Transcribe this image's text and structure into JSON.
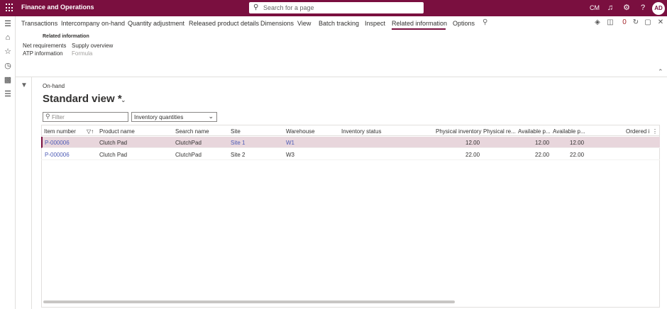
{
  "topbar": {
    "app_title": "Finance and Operations",
    "search_placeholder": "Search for a page",
    "company": "CM",
    "avatar_initials": "AD",
    "background": "#7a0f3f"
  },
  "action_pane": {
    "tabs": [
      {
        "label": "Transactions"
      },
      {
        "label": "Intercompany on-hand"
      },
      {
        "label": "Quantity adjustment"
      },
      {
        "label": "Released product details"
      },
      {
        "label": "Dimensions"
      },
      {
        "label": "View"
      },
      {
        "label": "Batch tracking"
      },
      {
        "label": "Inspect"
      },
      {
        "label": "Related information"
      },
      {
        "label": "Options"
      }
    ],
    "active_tab": "Related information",
    "group": {
      "title": "Related information",
      "links": [
        {
          "label": "Net requirements",
          "enabled": true
        },
        {
          "label": "Supply overview",
          "enabled": true
        },
        {
          "label": "ATP information",
          "enabled": true
        },
        {
          "label": "Formula",
          "enabled": false
        }
      ]
    },
    "notification_badge": "0"
  },
  "page": {
    "caption": "On-hand",
    "view_title": "Standard view *",
    "filter_placeholder": "Filter",
    "dropdown_value": "Inventory quantities"
  },
  "grid": {
    "columns": [
      {
        "label": "Item number"
      },
      {
        "label": "Product name"
      },
      {
        "label": "Search name"
      },
      {
        "label": "Site"
      },
      {
        "label": "Warehouse"
      },
      {
        "label": "Inventory status"
      },
      {
        "label": "Physical inventory"
      },
      {
        "label": "Physical re..."
      },
      {
        "label": "Available p..."
      },
      {
        "label": "Available p..."
      },
      {
        "label": "Ordered i"
      }
    ],
    "rows": [
      {
        "item_number": "P-000006",
        "product_name": "Clutch Pad",
        "search_name": "ClutchPad",
        "site": "Site 1",
        "warehouse": "W1",
        "inventory_status": "",
        "physical_inventory": "12.00",
        "available_1": "12.00",
        "available_2": "12.00",
        "selected": true
      },
      {
        "item_number": "P-000006",
        "product_name": "Clutch Pad",
        "search_name": "ClutchPad",
        "site": "Site 2",
        "warehouse": "W3",
        "inventory_status": "",
        "physical_inventory": "22.00",
        "available_1": "22.00",
        "available_2": "22.00",
        "selected": false
      }
    ]
  }
}
